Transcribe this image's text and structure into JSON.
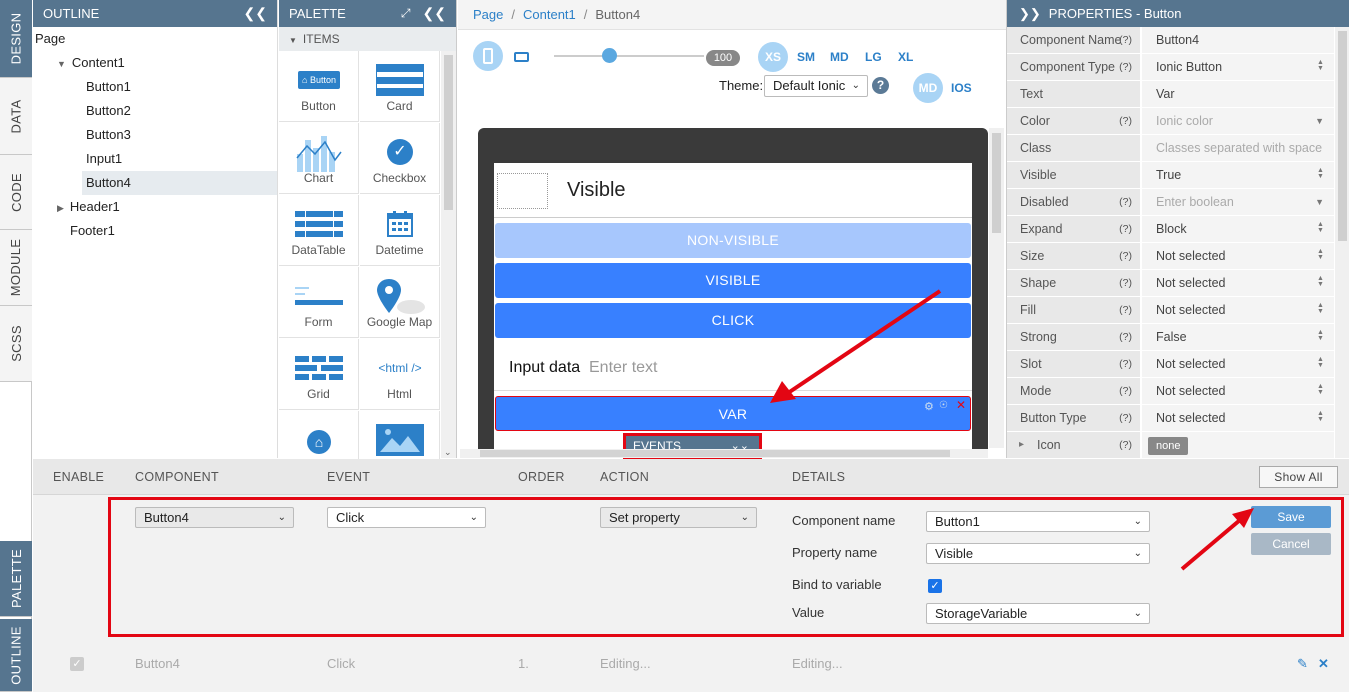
{
  "vtabs": {
    "design": "DESIGN",
    "data": "DATA",
    "code": "CODE",
    "module": "MODULE",
    "scss": "SCSS",
    "palette": "PALETTE",
    "outline": "OUTLINE"
  },
  "outline": {
    "title": "OUTLINE",
    "collapse_icon": "double-chevron-left-icon",
    "items": [
      "Page",
      "Content1",
      "Button1",
      "Button2",
      "Button3",
      "Input1",
      "Button4",
      "Header1",
      "Footer1"
    ]
  },
  "palette": {
    "title": "PALETTE",
    "section": "ITEMS",
    "items": [
      "Button",
      "Card",
      "Chart",
      "Checkbox",
      "DataTable",
      "Datetime",
      "Form",
      "Google Map",
      "Grid",
      "Html"
    ],
    "button_icon_text": "Button",
    "html_icon_text": "<html />"
  },
  "canvas": {
    "breadcrumb": [
      "Page",
      "Content1",
      "Button4"
    ],
    "zoom": "100",
    "breakpoints": [
      "XS",
      "SM",
      "MD",
      "LG",
      "XL"
    ],
    "theme_label": "Theme:",
    "theme_value": "Default Ionic",
    "modes": [
      "MD",
      "IOS"
    ],
    "header_title": "Visible",
    "buttons": [
      "NON-VISIBLE",
      "VISIBLE",
      "CLICK"
    ],
    "input_label": "Input data",
    "input_placeholder": "Enter text",
    "selected_button": "VAR",
    "events_tab": "EVENTS"
  },
  "properties": {
    "title": "PROPERTIES - Button",
    "rows": [
      {
        "key": "Component Name",
        "q": "(?)",
        "value": "Button4",
        "ph": false,
        "arrow": ""
      },
      {
        "key": "Component Type",
        "q": "(?)",
        "value": "Ionic Button",
        "ph": false,
        "arrow": "updown"
      },
      {
        "key": "Text",
        "q": "",
        "value": "Var",
        "ph": false,
        "arrow": ""
      },
      {
        "key": "Color",
        "q": "(?)",
        "value": "Ionic color",
        "ph": true,
        "arrow": "down"
      },
      {
        "key": "Class",
        "q": "",
        "value": "Classes separated with space",
        "ph": true,
        "arrow": ""
      },
      {
        "key": "Visible",
        "q": "",
        "value": "True",
        "ph": false,
        "arrow": "updown"
      },
      {
        "key": "Disabled",
        "q": "(?)",
        "value": "Enter boolean",
        "ph": true,
        "arrow": "down"
      },
      {
        "key": "Expand",
        "q": "(?)",
        "value": "Block",
        "ph": false,
        "arrow": "updown"
      },
      {
        "key": "Size",
        "q": "(?)",
        "value": "Not selected",
        "ph": false,
        "arrow": "updown"
      },
      {
        "key": "Shape",
        "q": "(?)",
        "value": "Not selected",
        "ph": false,
        "arrow": "updown"
      },
      {
        "key": "Fill",
        "q": "(?)",
        "value": "Not selected",
        "ph": false,
        "arrow": "updown"
      },
      {
        "key": "Strong",
        "q": "(?)",
        "value": "False",
        "ph": false,
        "arrow": "updown"
      },
      {
        "key": "Slot",
        "q": "(?)",
        "value": "Not selected",
        "ph": false,
        "arrow": "updown"
      },
      {
        "key": "Mode",
        "q": "(?)",
        "value": "Not selected",
        "ph": false,
        "arrow": "updown"
      },
      {
        "key": "Button Type",
        "q": "(?)",
        "value": "Not selected",
        "ph": false,
        "arrow": "updown"
      },
      {
        "key": "Icon",
        "q": "(?)",
        "value": "none",
        "ph": false,
        "arrow": ""
      }
    ]
  },
  "events": {
    "headers": [
      "ENABLE",
      "COMPONENT",
      "EVENT",
      "ORDER",
      "ACTION",
      "DETAILS"
    ],
    "show_all": "Show All",
    "component": "Button4",
    "event": "Click",
    "action": "Set property",
    "details": {
      "component_name_label": "Component name",
      "component_name_value": "Button1",
      "property_name_label": "Property name",
      "property_name_value": "Visible",
      "bind_label": "Bind to variable",
      "bind_checked": true,
      "value_label": "Value",
      "value_value": "StorageVariable"
    },
    "save": "Save",
    "cancel": "Cancel",
    "existing": {
      "component": "Button4",
      "event": "Click",
      "order": "1.",
      "action": "Editing...",
      "details": "Editing..."
    }
  },
  "colors": {
    "header_blue": "#56758f",
    "accent": "#2c80c8",
    "ionic_primary": "#3880ff",
    "annotation_red": "#e30613"
  }
}
